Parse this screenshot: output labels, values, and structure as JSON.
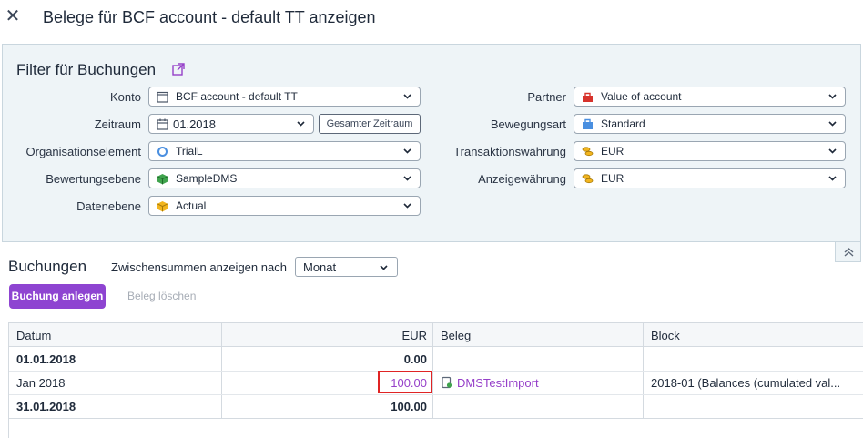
{
  "window": {
    "title": "Belege für BCF account - default TT anzeigen"
  },
  "filter": {
    "title": "Filter für Buchungen",
    "left": [
      {
        "label": "Konto",
        "value": "BCF account - default TT"
      },
      {
        "label": "Zeitraum",
        "value": "01.2018",
        "button": "Gesamter Zeitraum"
      },
      {
        "label": "Organisationselement",
        "value": "TrialL"
      },
      {
        "label": "Bewertungsebene",
        "value": "SampleDMS"
      },
      {
        "label": "Datenebene",
        "value": "Actual"
      }
    ],
    "right": [
      {
        "label": "Partner",
        "value": "Value of account"
      },
      {
        "label": "Bewegungsart",
        "value": "Standard"
      },
      {
        "label": "Transaktionswährung",
        "value": "EUR"
      },
      {
        "label": "Anzeigewährung",
        "value": "EUR"
      }
    ]
  },
  "bookings": {
    "title": "Buchungen",
    "subtotal_label": "Zwischensummen anzeigen nach",
    "subtotal_value": "Monat",
    "create_button": "Buchung anlegen",
    "delete_button": "Beleg löschen",
    "columns": [
      "Datum",
      "EUR",
      "Beleg",
      "Block"
    ],
    "rows": [
      {
        "date": "01.01.2018",
        "amount": "0.00",
        "doc": "",
        "block": "",
        "bold": true
      },
      {
        "date": "Jan 2018",
        "amount": "100.00",
        "doc": "DMSTestImport",
        "block": "2018-01 (Balances (cumulated val...",
        "bold": false
      },
      {
        "date": "31.01.2018",
        "amount": "100.00",
        "doc": "",
        "block": "",
        "bold": true
      }
    ]
  },
  "colors": {
    "accent": "#8e44d1",
    "link": "#9640c9",
    "highlight": "#e02424",
    "panel": "#eef4f7"
  }
}
